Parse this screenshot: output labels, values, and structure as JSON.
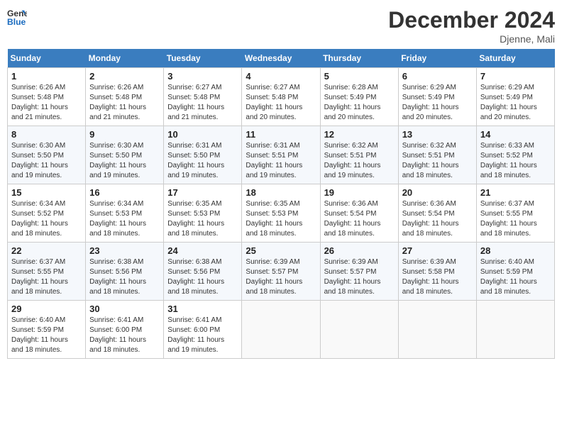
{
  "header": {
    "logo_line1": "General",
    "logo_line2": "Blue",
    "month_title": "December 2024",
    "location": "Djenne, Mali"
  },
  "weekdays": [
    "Sunday",
    "Monday",
    "Tuesday",
    "Wednesday",
    "Thursday",
    "Friday",
    "Saturday"
  ],
  "weeks": [
    [
      {
        "day": "1",
        "sunrise": "6:26 AM",
        "sunset": "5:48 PM",
        "daylight": "11 hours and 21 minutes."
      },
      {
        "day": "2",
        "sunrise": "6:26 AM",
        "sunset": "5:48 PM",
        "daylight": "11 hours and 21 minutes."
      },
      {
        "day": "3",
        "sunrise": "6:27 AM",
        "sunset": "5:48 PM",
        "daylight": "11 hours and 21 minutes."
      },
      {
        "day": "4",
        "sunrise": "6:27 AM",
        "sunset": "5:48 PM",
        "daylight": "11 hours and 20 minutes."
      },
      {
        "day": "5",
        "sunrise": "6:28 AM",
        "sunset": "5:49 PM",
        "daylight": "11 hours and 20 minutes."
      },
      {
        "day": "6",
        "sunrise": "6:29 AM",
        "sunset": "5:49 PM",
        "daylight": "11 hours and 20 minutes."
      },
      {
        "day": "7",
        "sunrise": "6:29 AM",
        "sunset": "5:49 PM",
        "daylight": "11 hours and 20 minutes."
      }
    ],
    [
      {
        "day": "8",
        "sunrise": "6:30 AM",
        "sunset": "5:50 PM",
        "daylight": "11 hours and 19 minutes."
      },
      {
        "day": "9",
        "sunrise": "6:30 AM",
        "sunset": "5:50 PM",
        "daylight": "11 hours and 19 minutes."
      },
      {
        "day": "10",
        "sunrise": "6:31 AM",
        "sunset": "5:50 PM",
        "daylight": "11 hours and 19 minutes."
      },
      {
        "day": "11",
        "sunrise": "6:31 AM",
        "sunset": "5:51 PM",
        "daylight": "11 hours and 19 minutes."
      },
      {
        "day": "12",
        "sunrise": "6:32 AM",
        "sunset": "5:51 PM",
        "daylight": "11 hours and 19 minutes."
      },
      {
        "day": "13",
        "sunrise": "6:32 AM",
        "sunset": "5:51 PM",
        "daylight": "11 hours and 18 minutes."
      },
      {
        "day": "14",
        "sunrise": "6:33 AM",
        "sunset": "5:52 PM",
        "daylight": "11 hours and 18 minutes."
      }
    ],
    [
      {
        "day": "15",
        "sunrise": "6:34 AM",
        "sunset": "5:52 PM",
        "daylight": "11 hours and 18 minutes."
      },
      {
        "day": "16",
        "sunrise": "6:34 AM",
        "sunset": "5:53 PM",
        "daylight": "11 hours and 18 minutes."
      },
      {
        "day": "17",
        "sunrise": "6:35 AM",
        "sunset": "5:53 PM",
        "daylight": "11 hours and 18 minutes."
      },
      {
        "day": "18",
        "sunrise": "6:35 AM",
        "sunset": "5:53 PM",
        "daylight": "11 hours and 18 minutes."
      },
      {
        "day": "19",
        "sunrise": "6:36 AM",
        "sunset": "5:54 PM",
        "daylight": "11 hours and 18 minutes."
      },
      {
        "day": "20",
        "sunrise": "6:36 AM",
        "sunset": "5:54 PM",
        "daylight": "11 hours and 18 minutes."
      },
      {
        "day": "21",
        "sunrise": "6:37 AM",
        "sunset": "5:55 PM",
        "daylight": "11 hours and 18 minutes."
      }
    ],
    [
      {
        "day": "22",
        "sunrise": "6:37 AM",
        "sunset": "5:55 PM",
        "daylight": "11 hours and 18 minutes."
      },
      {
        "day": "23",
        "sunrise": "6:38 AM",
        "sunset": "5:56 PM",
        "daylight": "11 hours and 18 minutes."
      },
      {
        "day": "24",
        "sunrise": "6:38 AM",
        "sunset": "5:56 PM",
        "daylight": "11 hours and 18 minutes."
      },
      {
        "day": "25",
        "sunrise": "6:39 AM",
        "sunset": "5:57 PM",
        "daylight": "11 hours and 18 minutes."
      },
      {
        "day": "26",
        "sunrise": "6:39 AM",
        "sunset": "5:57 PM",
        "daylight": "11 hours and 18 minutes."
      },
      {
        "day": "27",
        "sunrise": "6:39 AM",
        "sunset": "5:58 PM",
        "daylight": "11 hours and 18 minutes."
      },
      {
        "day": "28",
        "sunrise": "6:40 AM",
        "sunset": "5:59 PM",
        "daylight": "11 hours and 18 minutes."
      }
    ],
    [
      {
        "day": "29",
        "sunrise": "6:40 AM",
        "sunset": "5:59 PM",
        "daylight": "11 hours and 18 minutes."
      },
      {
        "day": "30",
        "sunrise": "6:41 AM",
        "sunset": "6:00 PM",
        "daylight": "11 hours and 18 minutes."
      },
      {
        "day": "31",
        "sunrise": "6:41 AM",
        "sunset": "6:00 PM",
        "daylight": "11 hours and 19 minutes."
      },
      null,
      null,
      null,
      null
    ]
  ],
  "labels": {
    "sunrise": "Sunrise:",
    "sunset": "Sunset:",
    "daylight": "Daylight:"
  }
}
